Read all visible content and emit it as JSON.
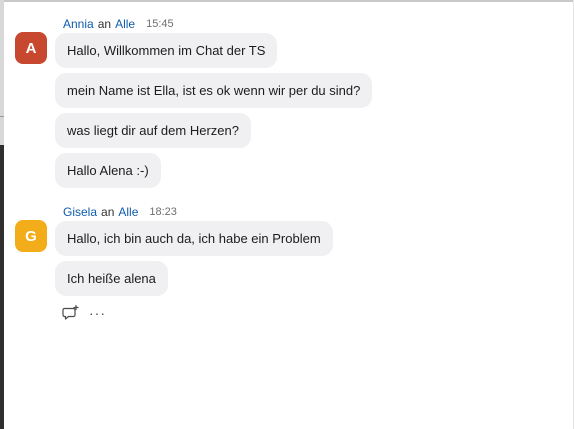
{
  "messages": [
    {
      "sender": "Annia",
      "to_word": "an",
      "recipient": "Alle",
      "time": "15:45",
      "avatar_letter": "A",
      "avatar_color": "#c8472f",
      "lines": [
        "Hallo, Willkommen im Chat der TS",
        "mein Name ist Ella, ist es ok wenn wir per du sind?",
        "was liegt dir auf dem Herzen?",
        "Hallo Alena :-)"
      ]
    },
    {
      "sender": "Gisela",
      "to_word": "an",
      "recipient": "Alle",
      "time": "18:23",
      "avatar_letter": "G",
      "avatar_color": "#f3ad1a",
      "lines": [
        "Hallo, ich bin auch da, ich habe ein Problem",
        "Ich heiße alena"
      ]
    }
  ],
  "actions": {
    "reply_icon": "reply-add-icon",
    "more_label": "···"
  },
  "colors": {
    "name_link": "#0e5cad",
    "bubble_bg": "#f0f0f3"
  }
}
